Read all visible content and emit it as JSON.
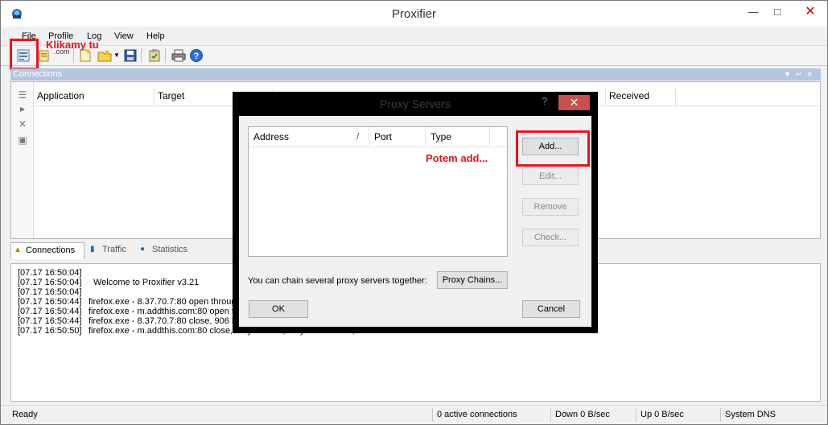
{
  "window": {
    "title": "Proxifier"
  },
  "menu": [
    "File",
    "Profile",
    "Log",
    "View",
    "Help"
  ],
  "annotations": {
    "klikamy": "Klikamy tu",
    "potem": "Potem add...",
    "colors": {
      "highlight": "#e8141e"
    }
  },
  "toolbar": {
    "com_label": ".com"
  },
  "connections": {
    "header": "Connections",
    "columns": [
      "Application",
      "Target",
      "Received"
    ]
  },
  "tabs": [
    "Connections",
    "Traffic",
    "Statistics"
  ],
  "log": [
    {
      "time": "[07.17 16:50:04]",
      "text": ""
    },
    {
      "time": "[07.17 16:50:04]",
      "text": "Welcome to Proxifier v3.21"
    },
    {
      "time": "[07.17 16:50:04]",
      "text": ""
    },
    {
      "time": "[07.17 16:50:44]",
      "text": "firefox.exe - 8.37.70.7:80 open through"
    },
    {
      "time": "[07.17 16:50:44]",
      "text": "firefox.exe - m.addthis.com:80 open thro"
    },
    {
      "time": "[07.17 16:50:44]",
      "text": "firefox.exe - 8.37.70.7:80 close, 906 byt"
    },
    {
      "time": "[07.17 16:50:50]",
      "text": "firefox.exe - m.addthis.com:80 close, 0 bytes sent, 0 bytes received, lifetime 00:06"
    }
  ],
  "status": {
    "ready": "Ready",
    "active": "0 active connections",
    "down": "Down 0 B/sec",
    "up": "Up 0 B/sec",
    "dns": "System DNS"
  },
  "dialog": {
    "title": "Proxy Servers",
    "help": "?",
    "close": "✕",
    "columns": [
      "Address",
      "/",
      "Port",
      "Type"
    ],
    "buttons": {
      "add": "Add...",
      "edit": "Edit...",
      "remove": "Remove",
      "check": "Check...",
      "ok": "OK",
      "cancel": "Cancel",
      "chains": "Proxy Chains..."
    },
    "chain_text": "You can chain several proxy servers together:"
  }
}
